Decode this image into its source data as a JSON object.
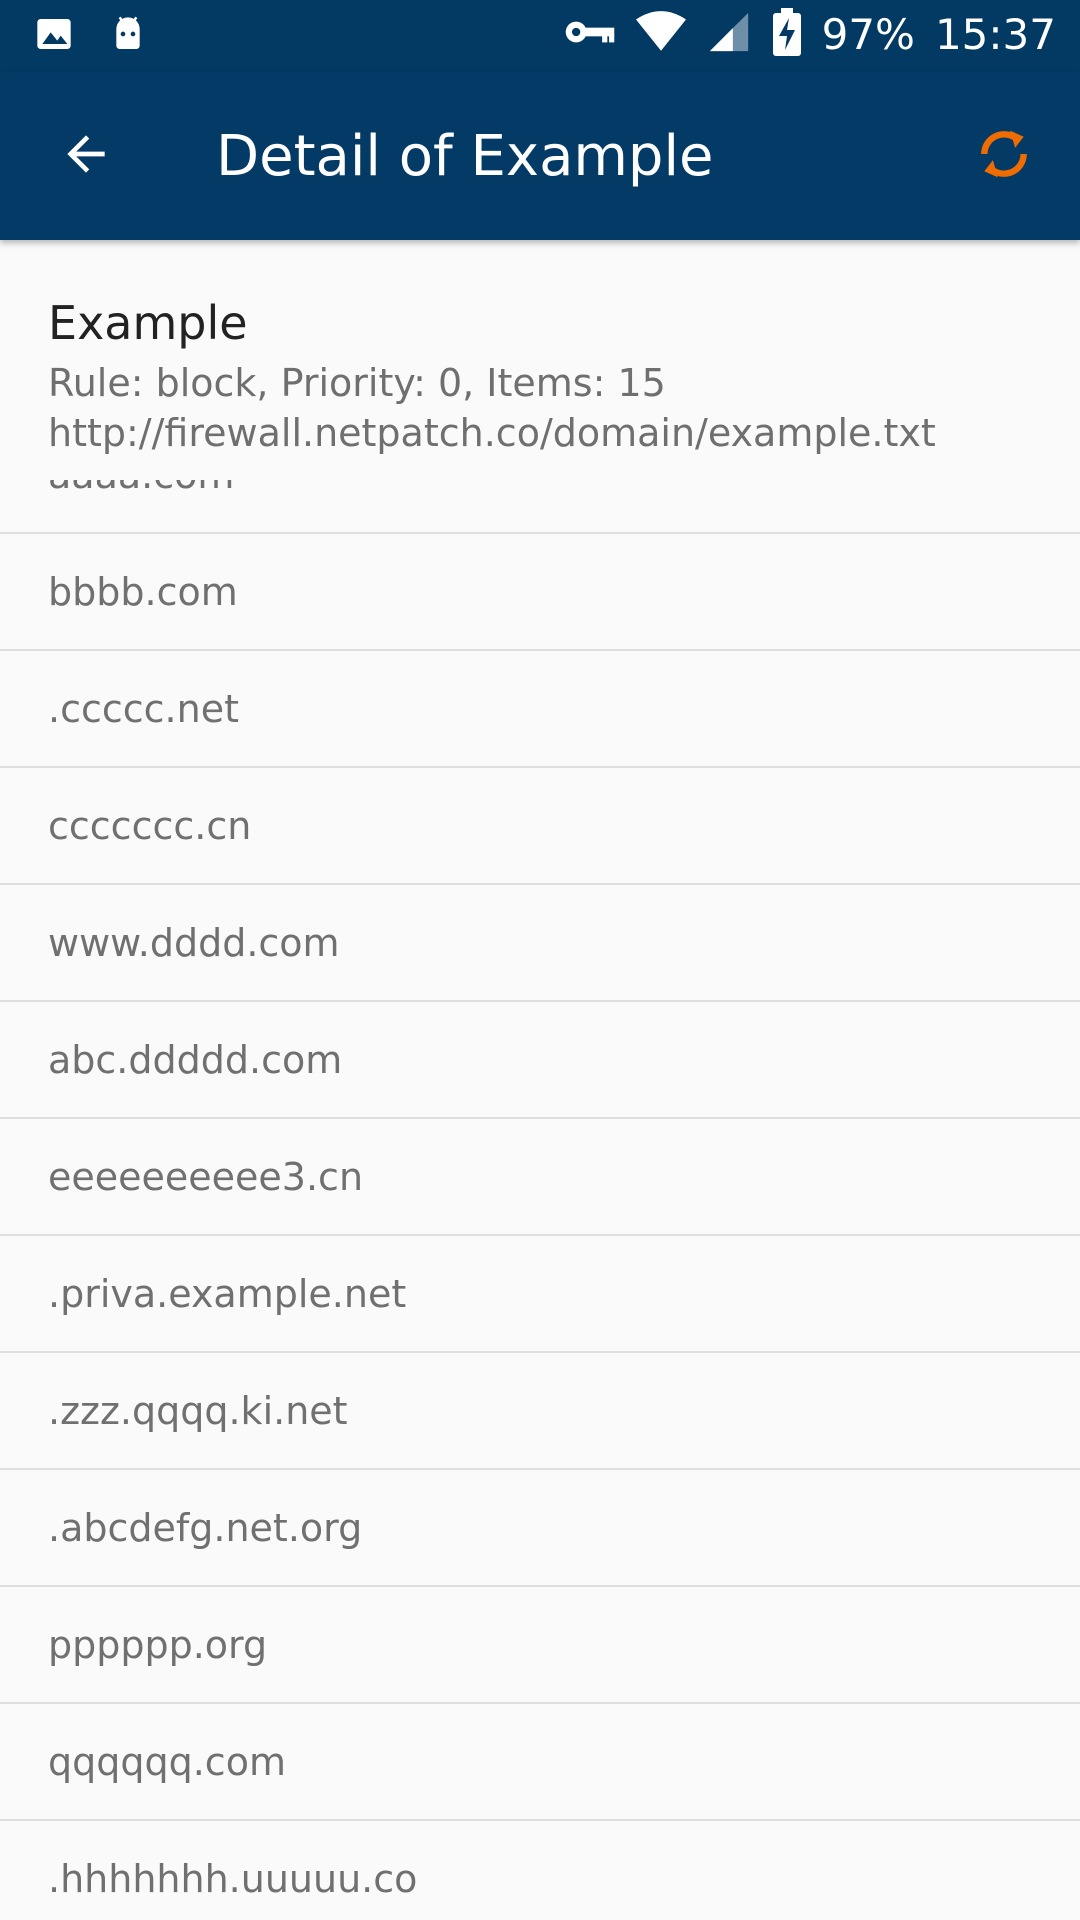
{
  "status_bar": {
    "battery": "97%",
    "time": "15:37",
    "icons": [
      "image-icon",
      "android-icon",
      "vpn-key-icon",
      "wifi-icon",
      "signal-icon",
      "battery-charging-icon"
    ]
  },
  "app_bar": {
    "title": "Detail of Example",
    "back_icon": "arrow-back-icon",
    "refresh_icon": "refresh-icon",
    "refresh_color": "#ef6c00",
    "background": "#033a66"
  },
  "header": {
    "name": "Example",
    "details": "Rule: block, Priority: 0, Items: 15",
    "url": "http://firewall.netpatch.co/domain/example.txt"
  },
  "items": [
    "aaaa.com",
    "bbbb.com",
    ".ccccc.net",
    "ccccccc.cn",
    "www.dddd.com",
    "abc.ddddd.com",
    "eeeeeeeeee3.cn",
    ".priva.example.net",
    ".zzz.qqqq.ki.net",
    ".abcdefg.net.org",
    "pppppp.org",
    "qqqqqq.com",
    ".hhhhhhh.uuuuu.co"
  ]
}
